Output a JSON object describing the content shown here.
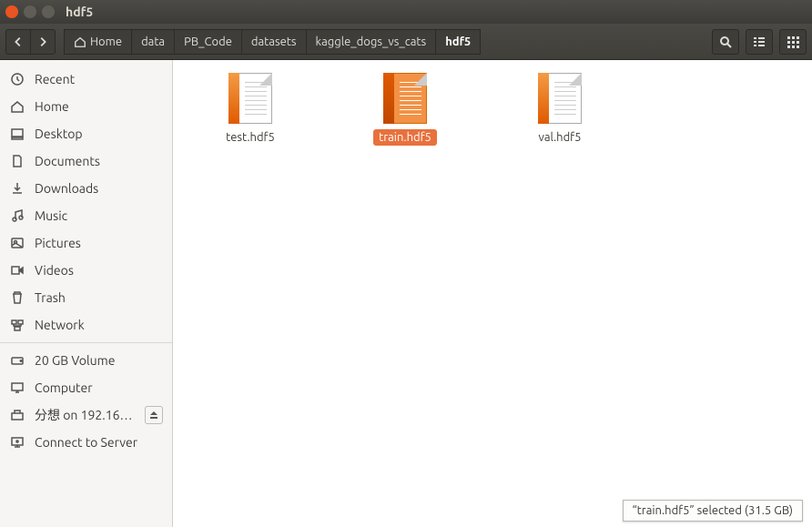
{
  "title": "hdf5",
  "breadcrumb": [
    {
      "label": "Home",
      "is_home": true
    },
    {
      "label": "data"
    },
    {
      "label": "PB_Code"
    },
    {
      "label": "datasets"
    },
    {
      "label": "kaggle_dogs_vs_cats"
    },
    {
      "label": "hdf5",
      "active": true
    }
  ],
  "sidebar": {
    "groups": [
      [
        {
          "icon": "recent",
          "label": "Recent"
        },
        {
          "icon": "home",
          "label": "Home"
        },
        {
          "icon": "desktop",
          "label": "Desktop"
        },
        {
          "icon": "documents",
          "label": "Documents"
        },
        {
          "icon": "downloads",
          "label": "Downloads"
        },
        {
          "icon": "music",
          "label": "Music"
        },
        {
          "icon": "pictures",
          "label": "Pictures"
        },
        {
          "icon": "videos",
          "label": "Videos"
        },
        {
          "icon": "trash",
          "label": "Trash"
        },
        {
          "icon": "network",
          "label": "Network"
        }
      ],
      [
        {
          "icon": "drive",
          "label": "20 GB Volume"
        },
        {
          "icon": "computer",
          "label": "Computer"
        },
        {
          "icon": "remote",
          "label": "分想 on 192.16…",
          "ejectable": true
        },
        {
          "icon": "connect",
          "label": "Connect to Server"
        }
      ]
    ]
  },
  "files": [
    {
      "name": "test.hdf5",
      "selected": false
    },
    {
      "name": "train.hdf5",
      "selected": true
    },
    {
      "name": "val.hdf5",
      "selected": false
    }
  ],
  "status": "“train.hdf5” selected (31.5 GB)",
  "accent": "#e8713d"
}
